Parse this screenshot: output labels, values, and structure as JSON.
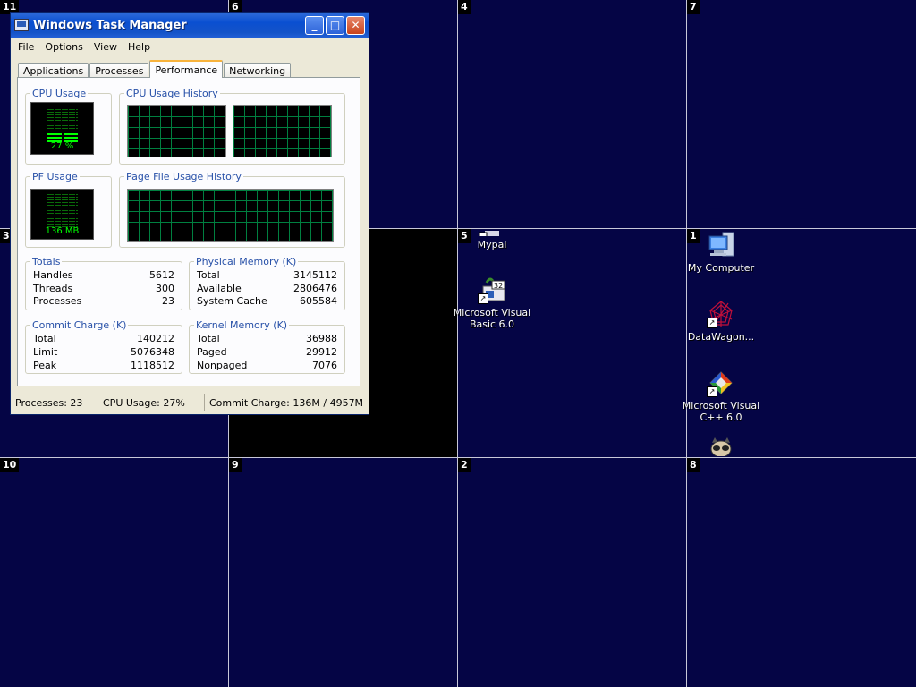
{
  "desktop": {
    "cell_numbers": [
      "11",
      "6",
      "4",
      "7",
      "3",
      "5",
      "1",
      "10",
      "9",
      "2",
      "8"
    ],
    "icons": {
      "mypal": {
        "label": "Mypal"
      },
      "vb6": {
        "label": "Microsoft Visual Basic 6.0"
      },
      "my_computer": {
        "label": "My Computer"
      },
      "datawagon": {
        "label": "DataWagon..."
      },
      "vcpp": {
        "label": "Microsoft Visual C++ 6.0"
      }
    }
  },
  "window": {
    "title": "Windows Task Manager",
    "controls": {
      "minimize": "_",
      "maximize": "□",
      "close": "✕"
    },
    "menu": [
      "File",
      "Options",
      "View",
      "Help"
    ],
    "tabs": [
      "Applications",
      "Processes",
      "Performance",
      "Networking"
    ],
    "active_tab": "Performance",
    "performance": {
      "cpu_usage": {
        "title": "CPU Usage",
        "value": "27 %",
        "percent": 27
      },
      "cpu_history": {
        "title": "CPU Usage History"
      },
      "pf_usage": {
        "title": "PF Usage",
        "value": "136 MB"
      },
      "pf_history": {
        "title": "Page File Usage History"
      },
      "totals": {
        "title": "Totals",
        "rows": [
          {
            "label": "Handles",
            "value": "5612"
          },
          {
            "label": "Threads",
            "value": "300"
          },
          {
            "label": "Processes",
            "value": "23"
          }
        ]
      },
      "physical_memory": {
        "title": "Physical Memory (K)",
        "rows": [
          {
            "label": "Total",
            "value": "3145112"
          },
          {
            "label": "Available",
            "value": "2806476"
          },
          {
            "label": "System Cache",
            "value": "605584"
          }
        ]
      },
      "commit_charge": {
        "title": "Commit Charge (K)",
        "rows": [
          {
            "label": "Total",
            "value": "140212"
          },
          {
            "label": "Limit",
            "value": "5076348"
          },
          {
            "label": "Peak",
            "value": "1118512"
          }
        ]
      },
      "kernel_memory": {
        "title": "Kernel Memory (K)",
        "rows": [
          {
            "label": "Total",
            "value": "36988"
          },
          {
            "label": "Paged",
            "value": "29912"
          },
          {
            "label": "Nonpaged",
            "value": "7076"
          }
        ]
      }
    },
    "status": {
      "processes": "Processes: 23",
      "cpu": "CPU Usage: 27%",
      "commit": "Commit Charge: 136M / 4957M"
    }
  }
}
